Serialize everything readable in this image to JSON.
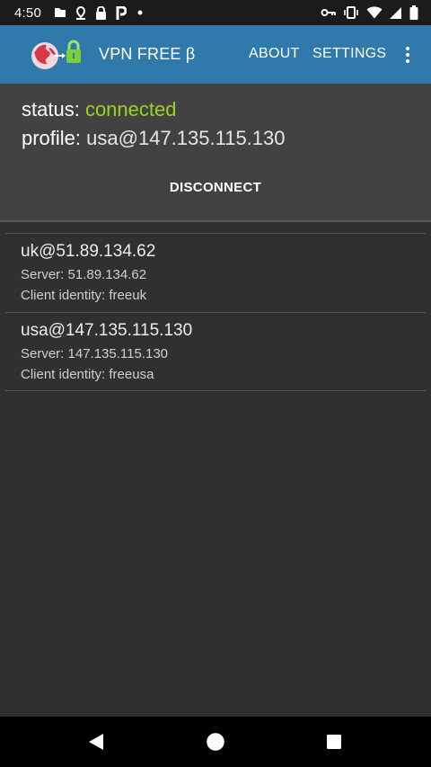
{
  "status_bar": {
    "time": "4:50",
    "icons_left": [
      "file-icon",
      "location-pin-icon",
      "lock-icon",
      "p-app-icon",
      "dot-icon"
    ],
    "icons_right": [
      "vpn-key-icon",
      "vibrate-icon",
      "wifi-icon",
      "signal-icon",
      "battery-icon"
    ]
  },
  "app_bar": {
    "title": "VPN FREE β",
    "about_label": "ABOUT",
    "settings_label": "SETTINGS",
    "colors": {
      "background": "#2f79ab"
    }
  },
  "status": {
    "status_label": "status:",
    "status_value": "connected",
    "profile_label": "profile:",
    "profile_value": "usa@147.135.115.130",
    "disconnect_label": "DISCONNECT",
    "colors": {
      "connected": "#9bd41c"
    }
  },
  "profiles": [
    {
      "name": "uk@51.89.134.62",
      "server": "Server: 51.89.134.62",
      "identity": "Client identity: freeuk"
    },
    {
      "name": "usa@147.135.115.130",
      "server": "Server: 147.135.115.130",
      "identity": "Client identity: freeusa"
    }
  ],
  "nav_bar": {
    "buttons": [
      "back-icon",
      "home-icon",
      "recents-icon"
    ]
  }
}
